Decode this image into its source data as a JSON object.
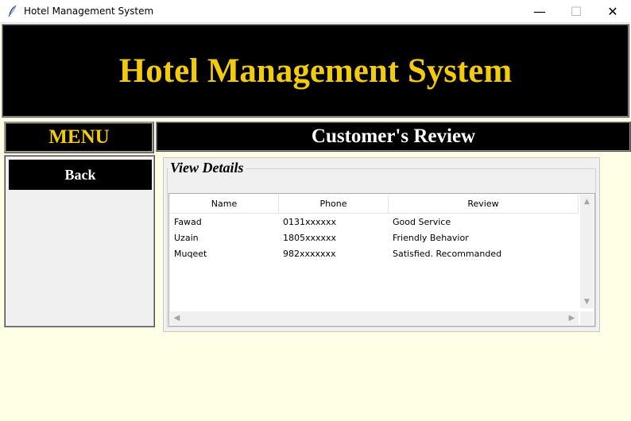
{
  "window": {
    "title": "Hotel Management System",
    "icon": "feather-icon",
    "controls": {
      "minimize": "—",
      "maximize": "☐",
      "close": "✕"
    }
  },
  "header": {
    "title": "Hotel Management System"
  },
  "menu": {
    "title": "MENU",
    "back_label": "Back"
  },
  "section": {
    "title": "Customer's Review"
  },
  "details": {
    "label": "View Details",
    "columns": [
      "Name",
      "Phone",
      "Review"
    ],
    "rows": [
      {
        "name": "Fawad",
        "phone": "0131xxxxxx",
        "review": "Good Service"
      },
      {
        "name": "Uzain",
        "phone": "1805xxxxxx",
        "review": "Friendly Behavior"
      },
      {
        "name": "Muqeet",
        "phone": "982xxxxxxx",
        "review": "Satisfied. Recommanded"
      }
    ]
  },
  "colors": {
    "header_bg": "#000000",
    "accent_gold": "#f2cb0c",
    "window_bg": "#ffffe6",
    "panel_bg": "#f0f0f0"
  }
}
